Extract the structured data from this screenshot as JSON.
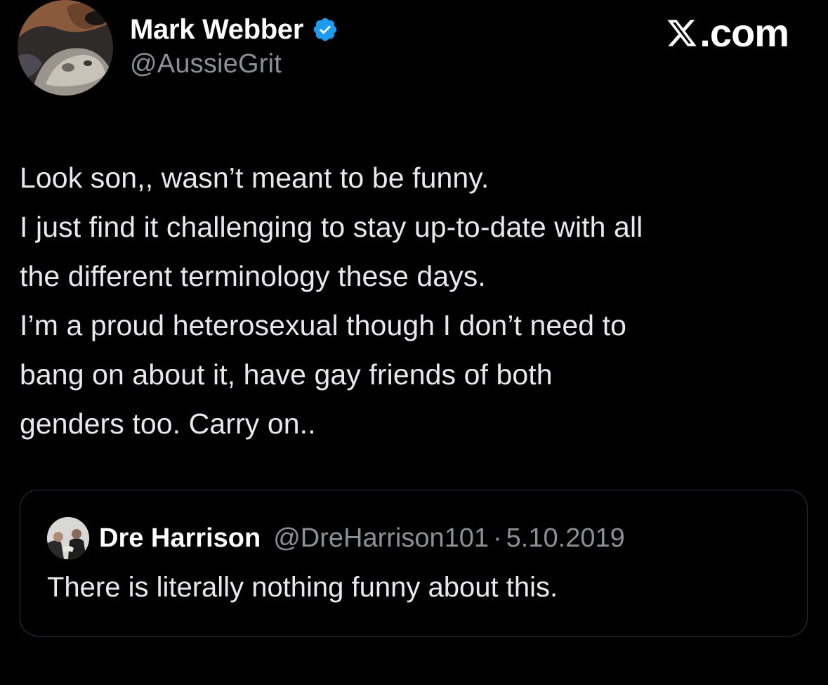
{
  "header": {
    "display_name": "Mark Webber",
    "handle": "@AussieGrit",
    "verified_icon": "verified-badge-icon",
    "brand": ".com",
    "brand_logo": "x-logo-icon",
    "verified_color": "#1d9bf0"
  },
  "tweet": {
    "lines": [
      "Look son,, wasn’t meant to be funny.",
      "I just find it challenging to stay up-to-date with all",
      "the different terminology these days.",
      "I’m a proud heterosexual though I don’t need to",
      "bang on about it, have gay friends of both",
      "genders too. Carry on.."
    ]
  },
  "quote": {
    "display_name": "Dre Harrison",
    "handle": "@DreHarrison101",
    "separator": "·",
    "date": "5.10.2019",
    "text": "There is literally nothing funny about this."
  },
  "colors": {
    "background": "#000000",
    "text": "#e7e9ea",
    "secondary": "#8b9096",
    "border": "#2f3336"
  }
}
